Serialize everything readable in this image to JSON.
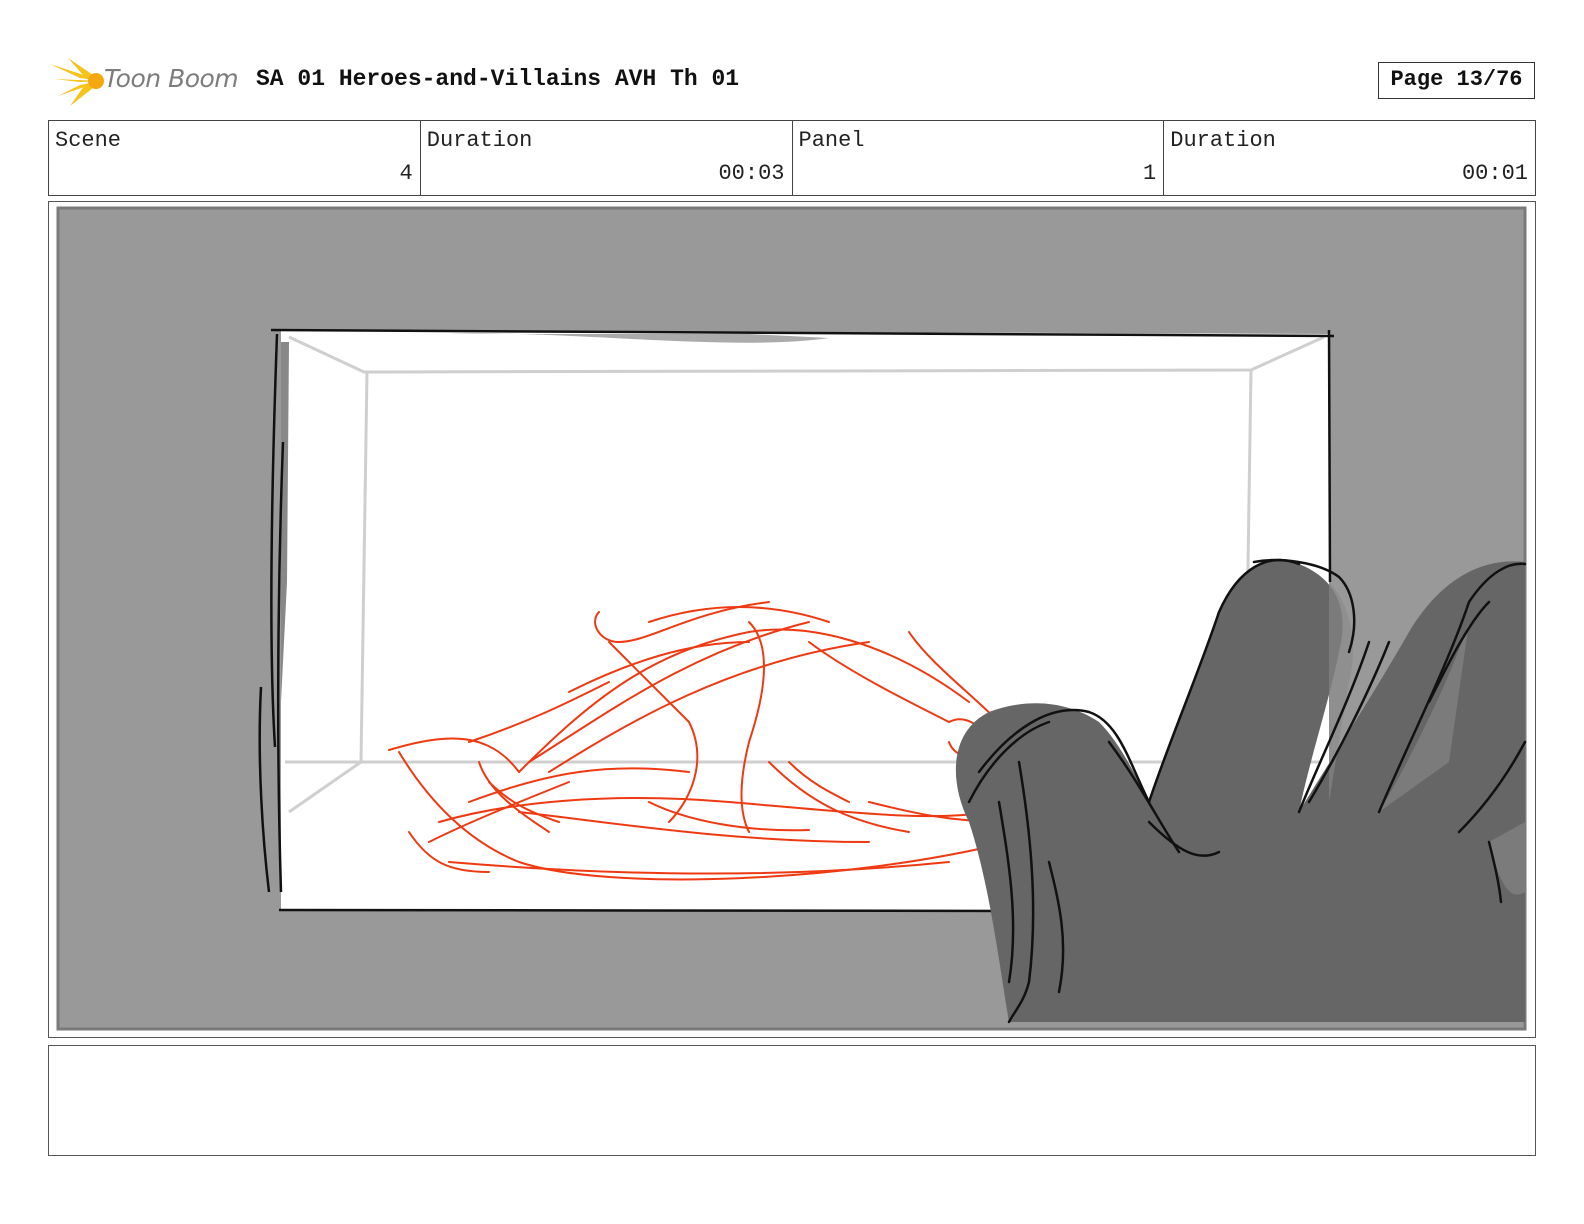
{
  "header": {
    "logo_text": "Toon Boom",
    "title": "SA 01 Heroes-and-Villains AVH Th 01",
    "page": "Page 13/76"
  },
  "info": {
    "scene_label": "Scene",
    "scene_value": "4",
    "scene_duration_label": "Duration",
    "scene_duration_value": "00:03",
    "panel_label": "Panel",
    "panel_value": "1",
    "panel_duration_label": "Duration",
    "panel_duration_value": "00:01"
  },
  "colors": {
    "background_gray": "#999999",
    "hand_gray": "#666666",
    "sketch_red": "#ee3a12",
    "logo_yellow": "#f7c21a"
  },
  "notes": ""
}
